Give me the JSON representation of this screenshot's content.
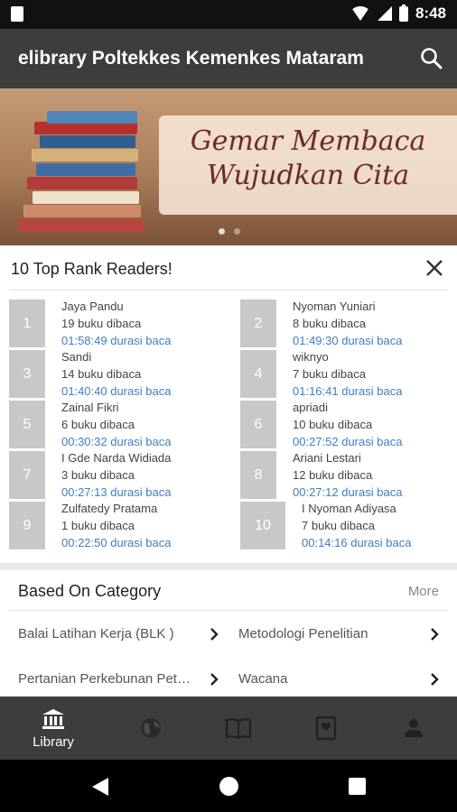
{
  "status_bar": {
    "time": "8:48"
  },
  "app_bar": {
    "title": "elibrary Poltekkes Kemenkes Mataram",
    "search_icon": "search-icon"
  },
  "banner": {
    "line1": "Gemar Membaca",
    "line2": "Wujudkan Cita"
  },
  "top_readers": {
    "title": "10 Top Rank Readers!",
    "close_icon": "close-icon",
    "readers": [
      {
        "rank": "1",
        "name": "Jaya Pandu",
        "books": "19 buku dibaca",
        "duration": "01:58:49 durasi baca"
      },
      {
        "rank": "2",
        "name": "Nyoman Yuniari",
        "books": "8 buku dibaca",
        "duration": "01:49:30 durasi baca"
      },
      {
        "rank": "3",
        "name": "Sandi",
        "books": "14 buku dibaca",
        "duration": "01:40:40 durasi baca"
      },
      {
        "rank": "4",
        "name": "wiknyo",
        "books": "7 buku dibaca",
        "duration": "01:16:41 durasi baca"
      },
      {
        "rank": "5",
        "name": "Zainal Fikri",
        "books": "6 buku dibaca",
        "duration": "00:30:32 durasi baca"
      },
      {
        "rank": "6",
        "name": "apriadi",
        "books": "10 buku dibaca",
        "duration": "00:27:52 durasi baca"
      },
      {
        "rank": "7",
        "name": "I Gde Narda Widiada",
        "books": "3 buku dibaca",
        "duration": "00:27:13 durasi baca"
      },
      {
        "rank": "8",
        "name": "Ariani Lestari",
        "books": "12 buku dibaca",
        "duration": "00:27:12 durasi baca"
      },
      {
        "rank": "9",
        "name": "Zulfatedy Pratama",
        "books": "1 buku dibaca",
        "duration": "00:22:50 durasi baca"
      },
      {
        "rank": "10",
        "name": "I Nyoman Adiyasa",
        "books": "7 buku dibaca",
        "duration": "00:14:16 durasi baca"
      }
    ]
  },
  "category": {
    "title": "Based On Category",
    "more": "More",
    "items": [
      {
        "label": "Balai Latihan Kerja (BLK )"
      },
      {
        "label": "Metodologi Penelitian"
      },
      {
        "label": "Pertanian Perkebunan Peternakan"
      },
      {
        "label": "Wacana"
      }
    ]
  },
  "bottom_nav": {
    "items": [
      {
        "label": "Library",
        "icon": "library-icon",
        "active": true
      },
      {
        "label": "",
        "icon": "globe-icon",
        "active": false
      },
      {
        "label": "",
        "icon": "book-icon",
        "active": false
      },
      {
        "label": "",
        "icon": "favorite-book-icon",
        "active": false
      },
      {
        "label": "",
        "icon": "profile-icon",
        "active": false
      }
    ]
  },
  "colors": {
    "appbar": "#3d3d3d",
    "link": "#3f7ec4",
    "rank_box": "#c8c8c8"
  }
}
